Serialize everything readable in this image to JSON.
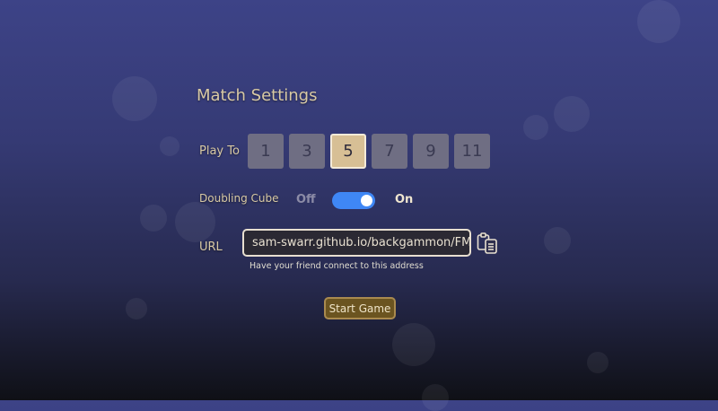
{
  "settings": {
    "title": "Match Settings",
    "play_to": {
      "label": "Play To",
      "options": [
        "1",
        "3",
        "5",
        "7",
        "9",
        "11"
      ],
      "selected": "5"
    },
    "doubling_cube": {
      "label": "Doubling Cube",
      "off_label": "Off",
      "on_label": "On",
      "enabled": true
    },
    "url": {
      "label": "URL",
      "value": "sam-swarr.github.io/backgammon/FMGA",
      "hint": "Have your friend connect to this address",
      "copy_icon": "clipboard-icon"
    },
    "start_button": "Start Game"
  },
  "colors": {
    "accent_gold": "#d7bf95",
    "toggle_blue": "#3f87f5",
    "button_brown": "#6b5420"
  }
}
